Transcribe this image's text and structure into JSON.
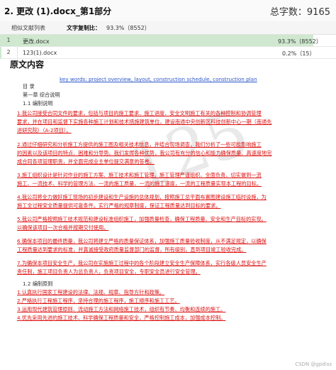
{
  "header": {
    "title": "2. 更改 (1).docx_第1部分",
    "total_label": "总字数：9165"
  },
  "subheader": {
    "similar_label": "相似文献列表",
    "copy_label": "文字复制比：",
    "copy_value": "93.3%（8552）"
  },
  "sources": [
    {
      "num": "1",
      "name": "更改.docx",
      "value": "93.3%（8552）",
      "fill": 0.933
    },
    {
      "num": "2",
      "name": "123(1).docx",
      "value": "0.2%（15）",
      "fill": 0.002
    }
  ],
  "section_title": "原文内容",
  "watermark": "125",
  "footer_mark": "CSDN @gpdiss",
  "lines": [
    {
      "t": "key words: project overview, layout, construction schedule, construction plan",
      "c": "blue"
    },
    {
      "t": "目 录",
      "c": "black"
    },
    {
      "t": "第一章 综合说明",
      "c": "black"
    },
    {
      "t": "1.1 编制说明",
      "c": "black"
    },
    {
      "t": "1.我公司接受合同文件的要求，包括与项目的施工要求、施工进度、安全文明施工有关的各种控制和协调管理",
      "c": "red"
    },
    {
      "t": "要求，并在项目和监督下实施各种施工计划和技术措施建筑单位，建设南通中央创新区科技创新中心一期（南通先",
      "c": "red"
    },
    {
      "t": "进研究院）（A-2项目）。",
      "c": "red"
    },
    {
      "t": "2.通过仔细研究和分析施工方提供的施工图及相关技术信息，并结合现场调查，我们分析了一些可能影响施工",
      "c": "red"
    },
    {
      "t": "的因素以及该项目的特点、困难和分导势。我们发挥各种优势，我公司有充分的信心和能力确保质量、高速度地完",
      "c": "red"
    },
    {
      "t": "成合同各项管理职责，并全面完成业主单位提交满意的答卷。",
      "c": "red"
    },
    {
      "t": "3.施工组织设计是针对作业的施工方案、施工技术和施工管理。施工管理严谨组织、全面负责、切实做到一流",
      "c": "red"
    },
    {
      "t": "施工、一流技术、科学的管理方法、一流的施工质量、一流的施工速度，一流的工程质量实现本工程的目标。",
      "c": "red"
    },
    {
      "t": "4.我公司将全力做好施工现场的初步建设和生产设施的总体规划，按照施工总平面布置图建设施工临时设施，为",
      "c": "red"
    },
    {
      "t": "施工全过程安全质量提供可靠条件。实行严格的规章制度，保证工程质量达到目标的要求。",
      "c": "red"
    },
    {
      "t": "5.我公司严格按照施工技术规范和建设标准组织施工，加强质量检查，确保工程质量、安全和生产目标的实现。",
      "c": "red"
    },
    {
      "t": "以确保该项目一次合格并按期交付使用。",
      "c": "red"
    },
    {
      "t": "6.确保本项目的最终质量，我公司将建立严格的质量保证体系，加强施工质量验收制度，从不满足规定，以确保",
      "c": "red"
    },
    {
      "t": "工程质量达到要求的标准，并真诚接受政府质量监督部门的监督，所有级别，直到项目竣工验收完成。",
      "c": "red"
    },
    {
      "t": "7.为确保本项目安全生产，我公司在实施施工过程中的各个阶段建立安全生产保障体系，实行各级人员安全生产",
      "c": "red"
    },
    {
      "t": "责任制，施工项目负责人为总负责人，负责项目安全，专职安全员进行安全管理。",
      "c": "red"
    },
    {
      "t": "1.2 编制原则",
      "c": "black"
    },
    {
      "t": "1.认真执行国家工程建设的法律、法规、规章、指导方针和政策。",
      "c": "red"
    },
    {
      "t": "2.严格执行工程施工程序，坚持合理的施工程序，施工顺序和施工工艺。",
      "c": "red"
    },
    {
      "t": "3.运用现代建筑管理原则、流动施工方法和网络施工技术，组织有节奏、均衡和连续的施工。",
      "c": "red"
    },
    {
      "t": "4.优先采用先进的施工技术、科学确保工程质量和安全，严格控制施工成本，加强成本控制。",
      "c": "red"
    }
  ]
}
